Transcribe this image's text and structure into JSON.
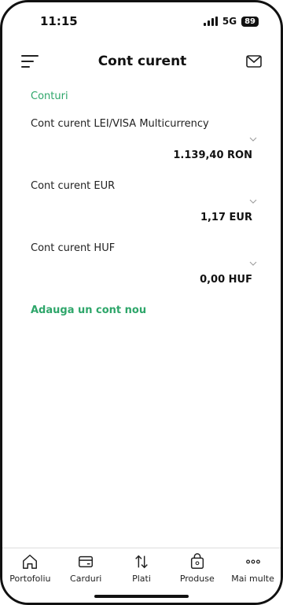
{
  "status": {
    "time": "11:15",
    "network": "5G",
    "battery": "89"
  },
  "header": {
    "title": "Cont curent"
  },
  "accounts_section": {
    "title": "Conturi"
  },
  "accounts": [
    {
      "name": "Cont curent LEI/VISA Multicurrency",
      "balance": "1.139,40 RON"
    },
    {
      "name": "Cont curent EUR",
      "balance": "1,17 EUR"
    },
    {
      "name": "Cont curent HUF",
      "balance": "0,00 HUF"
    }
  ],
  "add_account": {
    "label": "Adauga un cont nou"
  },
  "tabbar": {
    "items": [
      {
        "label": "Portofoliu",
        "icon": "home-icon"
      },
      {
        "label": "Carduri",
        "icon": "card-icon"
      },
      {
        "label": "Plati",
        "icon": "transfer-icon"
      },
      {
        "label": "Produse",
        "icon": "shopping-bag-icon"
      },
      {
        "label": "Mai multe",
        "icon": "more-icon"
      }
    ]
  },
  "colors": {
    "accent": "#2ea66a",
    "text": "#111111"
  }
}
